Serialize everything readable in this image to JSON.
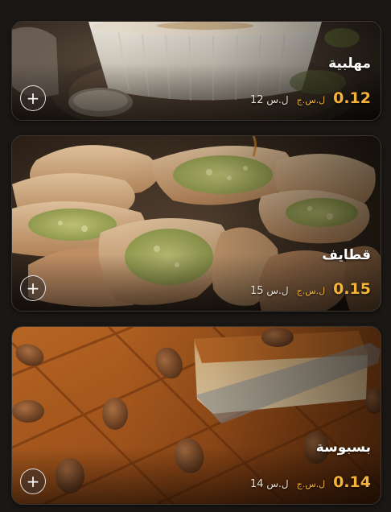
{
  "items": [
    {
      "name": "مهلبية",
      "price": "0.12",
      "currency": "ل.س.ج",
      "old_price": "12",
      "old_currency": "ل.س",
      "add_label": "+"
    },
    {
      "name": "قطايف",
      "price": "0.15",
      "currency": "ل.س.ج",
      "old_price": "15",
      "old_currency": "ل.س",
      "add_label": "+"
    },
    {
      "name": "بسبوسة",
      "price": "0.14",
      "currency": "ل.س.ج",
      "old_price": "14",
      "old_currency": "ل.س",
      "add_label": "+"
    }
  ],
  "colors": {
    "background": "#1a1714",
    "price_accent": "#f5b437",
    "card_border": "#3a352f"
  },
  "icons": [
    "plus-icon"
  ]
}
